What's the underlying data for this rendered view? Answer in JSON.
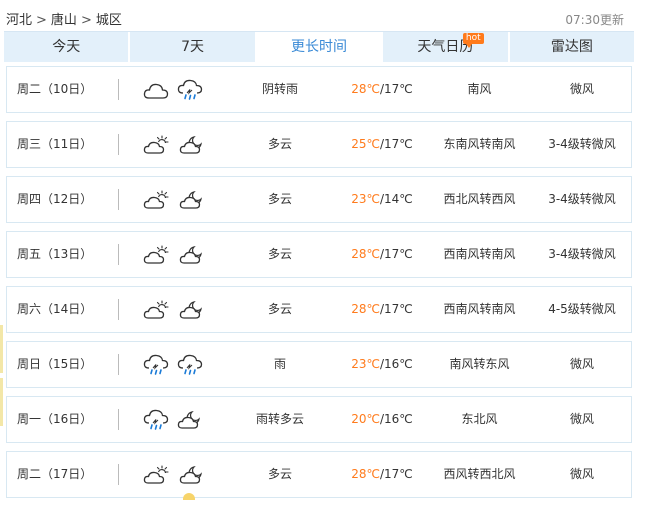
{
  "breadcrumb": {
    "province": "河北",
    "city": "唐山",
    "district": "城区",
    "separator": ">"
  },
  "update_time": "07:30更新",
  "tabs": [
    {
      "label": "今天"
    },
    {
      "label": "7天"
    },
    {
      "label": "更长时间",
      "active": true
    },
    {
      "label": "天气日历",
      "badge": "hot"
    },
    {
      "label": "雷达图"
    }
  ],
  "forecast": [
    {
      "day": "周二（10日）",
      "icons": [
        "cloud-icon",
        "rain-cloud-icon"
      ],
      "weather": "阴转雨",
      "high": "28℃",
      "low": "17℃",
      "wind": "南风",
      "level": "微风"
    },
    {
      "day": "周三（11日）",
      "icons": [
        "partly-cloudy-icon",
        "partly-cloudy-moon-icon"
      ],
      "weather": "多云",
      "high": "25℃",
      "low": "17℃",
      "wind": "东南风转南风",
      "level": "3-4级转微风"
    },
    {
      "day": "周四（12日）",
      "icons": [
        "partly-cloudy-icon",
        "partly-cloudy-moon-icon"
      ],
      "weather": "多云",
      "high": "23℃",
      "low": "14℃",
      "wind": "西北风转西风",
      "level": "3-4级转微风"
    },
    {
      "day": "周五（13日）",
      "icons": [
        "partly-cloudy-icon",
        "partly-cloudy-moon-icon"
      ],
      "weather": "多云",
      "high": "28℃",
      "low": "17℃",
      "wind": "西南风转南风",
      "level": "3-4级转微风"
    },
    {
      "day": "周六（14日）",
      "icons": [
        "partly-cloudy-icon",
        "partly-cloudy-moon-icon"
      ],
      "weather": "多云",
      "high": "28℃",
      "low": "17℃",
      "wind": "西南风转南风",
      "level": "4-5级转微风"
    },
    {
      "day": "周日（15日）",
      "icons": [
        "rain-cloud-icon",
        "rain-cloud-icon"
      ],
      "weather": "雨",
      "high": "23℃",
      "low": "16℃",
      "wind": "南风转东风",
      "level": "微风"
    },
    {
      "day": "周一（16日）",
      "icons": [
        "rain-cloud-icon",
        "partly-cloudy-moon-icon"
      ],
      "weather": "雨转多云",
      "high": "20℃",
      "low": "16℃",
      "wind": "东北风",
      "level": "微风"
    },
    {
      "day": "周二（17日）",
      "icons": [
        "partly-cloudy-icon",
        "partly-cloudy-moon-icon"
      ],
      "weather": "多云",
      "high": "28℃",
      "low": "17℃",
      "wind": "西风转西北风",
      "level": "微风"
    }
  ],
  "colors": {
    "accent": "#3a8ad6",
    "high_temp": "#ff7b1c",
    "tab_bg": "#e3f0fa",
    "row_border": "#d8e8f2",
    "hot_badge": "#ff7a1a"
  }
}
